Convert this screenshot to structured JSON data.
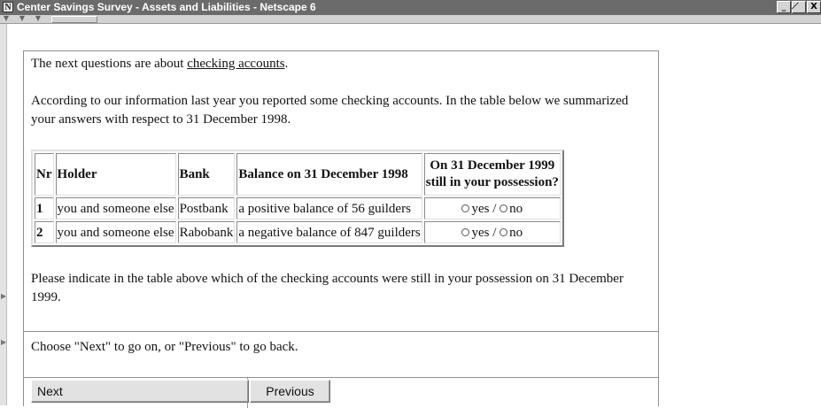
{
  "window": {
    "title": "Center Savings Survey - Assets and Liabilities - Netscape 6",
    "app_icon": "N",
    "controls": {
      "minimize": "_",
      "maximize": "̸",
      "close": "X"
    }
  },
  "page": {
    "intro": {
      "before": "The next questions are about ",
      "link": "checking accounts",
      "after": "."
    },
    "info": "According to our information last year you reported some checking accounts. In the table below we summarized your answers with respect to 31 December 1998.",
    "table": {
      "headers": [
        "Nr",
        "Holder",
        "Bank",
        "Balance on 31 December 1998",
        "On 31 December 1999",
        "still in your possession?"
      ],
      "rows": [
        {
          "nr": "1",
          "holder": "you and someone else",
          "bank": "Postbank",
          "balance": "a positive balance of 56 guilders",
          "yes": "yes /",
          "no": "no"
        },
        {
          "nr": "2",
          "holder": "you and someone else",
          "bank": "Rabobank",
          "balance": "a negative balance of 847 guilders",
          "yes": "yes /",
          "no": "no"
        }
      ]
    },
    "instruction": "Please indicate in the table above which of the checking accounts were still in your possession on 31 December 1999.",
    "navigation_hint": "Choose \"Next\" to go on, or \"Previous\" to go back.",
    "buttons": {
      "next": "Next",
      "previous": "Previous"
    }
  },
  "colors": {
    "titlebar": "#6b6b6b",
    "chrome": "#d4d4d4",
    "button": "#e2e2e2"
  }
}
